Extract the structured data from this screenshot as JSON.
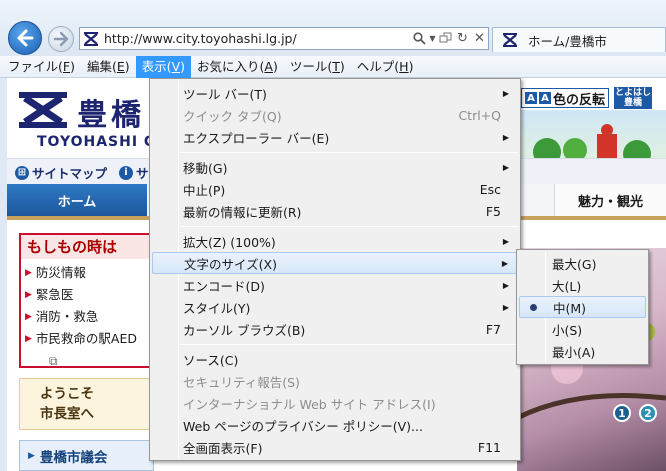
{
  "browser": {
    "address_url": "http://www.city.toyohashi.lg.jp/",
    "tab_title": "ホーム/豊橋市"
  },
  "menubar": [
    {
      "label": "ファイル(",
      "mnemonic": "F",
      "suffix": ")"
    },
    {
      "label": "編集(",
      "mnemonic": "E",
      "suffix": ")"
    },
    {
      "label": "表示(",
      "mnemonic": "V",
      "suffix": ")"
    },
    {
      "label": "お気に入り(",
      "mnemonic": "A",
      "suffix": ")"
    },
    {
      "label": "ツール(",
      "mnemonic": "T",
      "suffix": ")"
    },
    {
      "label": "ヘルプ(",
      "mnemonic": "H",
      "suffix": ")"
    }
  ],
  "view_menu": {
    "items": [
      {
        "label": "ツール バー(T)",
        "shortcut": "",
        "submenu": true
      },
      {
        "label": "クイック タブ(Q)",
        "shortcut": "Ctrl+Q",
        "disabled": true
      },
      {
        "label": "エクスプローラー バー(E)",
        "shortcut": "",
        "submenu": true
      },
      {
        "label": "移動(G)",
        "shortcut": "",
        "submenu": true
      },
      {
        "label": "中止(P)",
        "shortcut": "Esc"
      },
      {
        "label": "最新の情報に更新(R)",
        "shortcut": "F5"
      },
      {
        "label": "拡大(Z) (100%)",
        "shortcut": "",
        "submenu": true
      },
      {
        "label": "文字のサイズ(X)",
        "shortcut": "",
        "submenu": true,
        "highlighted": true
      },
      {
        "label": "エンコード(D)",
        "shortcut": "",
        "submenu": true
      },
      {
        "label": "スタイル(Y)",
        "shortcut": "",
        "submenu": true
      },
      {
        "label": "カーソル ブラウズ(B)",
        "shortcut": "F7"
      },
      {
        "label": "ソース(C)",
        "shortcut": ""
      },
      {
        "label": "セキュリティ報告(S)",
        "shortcut": "",
        "disabled": true
      },
      {
        "label": "インターナショナル Web サイト アドレス(I)",
        "shortcut": "",
        "disabled": true
      },
      {
        "label": "Web ページのプライバシー ポリシー(V)...",
        "shortcut": ""
      },
      {
        "label": "全画面表示(F)",
        "shortcut": "F11"
      }
    ]
  },
  "text_size_menu": {
    "items": [
      {
        "label": "最大(G)"
      },
      {
        "label": "大(L)"
      },
      {
        "label": "中(M)",
        "selected": true
      },
      {
        "label": "小(S)"
      },
      {
        "label": "最小(A)"
      }
    ]
  },
  "page": {
    "logo_jp": "豊橋",
    "logo_en": "TOYOHASHI CI",
    "sitemap": "サイトマップ",
    "util_2": "サ",
    "home_tab": "ホーム",
    "kanko_tab": "魅力・観光",
    "color_toggle": "色の反転",
    "yasashi_1": "とよはし",
    "yasashi_2": "豊橋",
    "emergency": {
      "heading": "もしもの時は",
      "links": [
        "防災情報",
        "緊急医",
        "消防・救急",
        "市民救命の駅AED"
      ]
    },
    "welcome_1": "ようこそ",
    "welcome_2": "市長室へ",
    "council": "豊橋市議会",
    "pager": [
      "1",
      "2"
    ]
  },
  "colors": {
    "menu_active": "#3399ff",
    "brand_navy": "#1d2570",
    "emergency_red": "#c8102e"
  }
}
